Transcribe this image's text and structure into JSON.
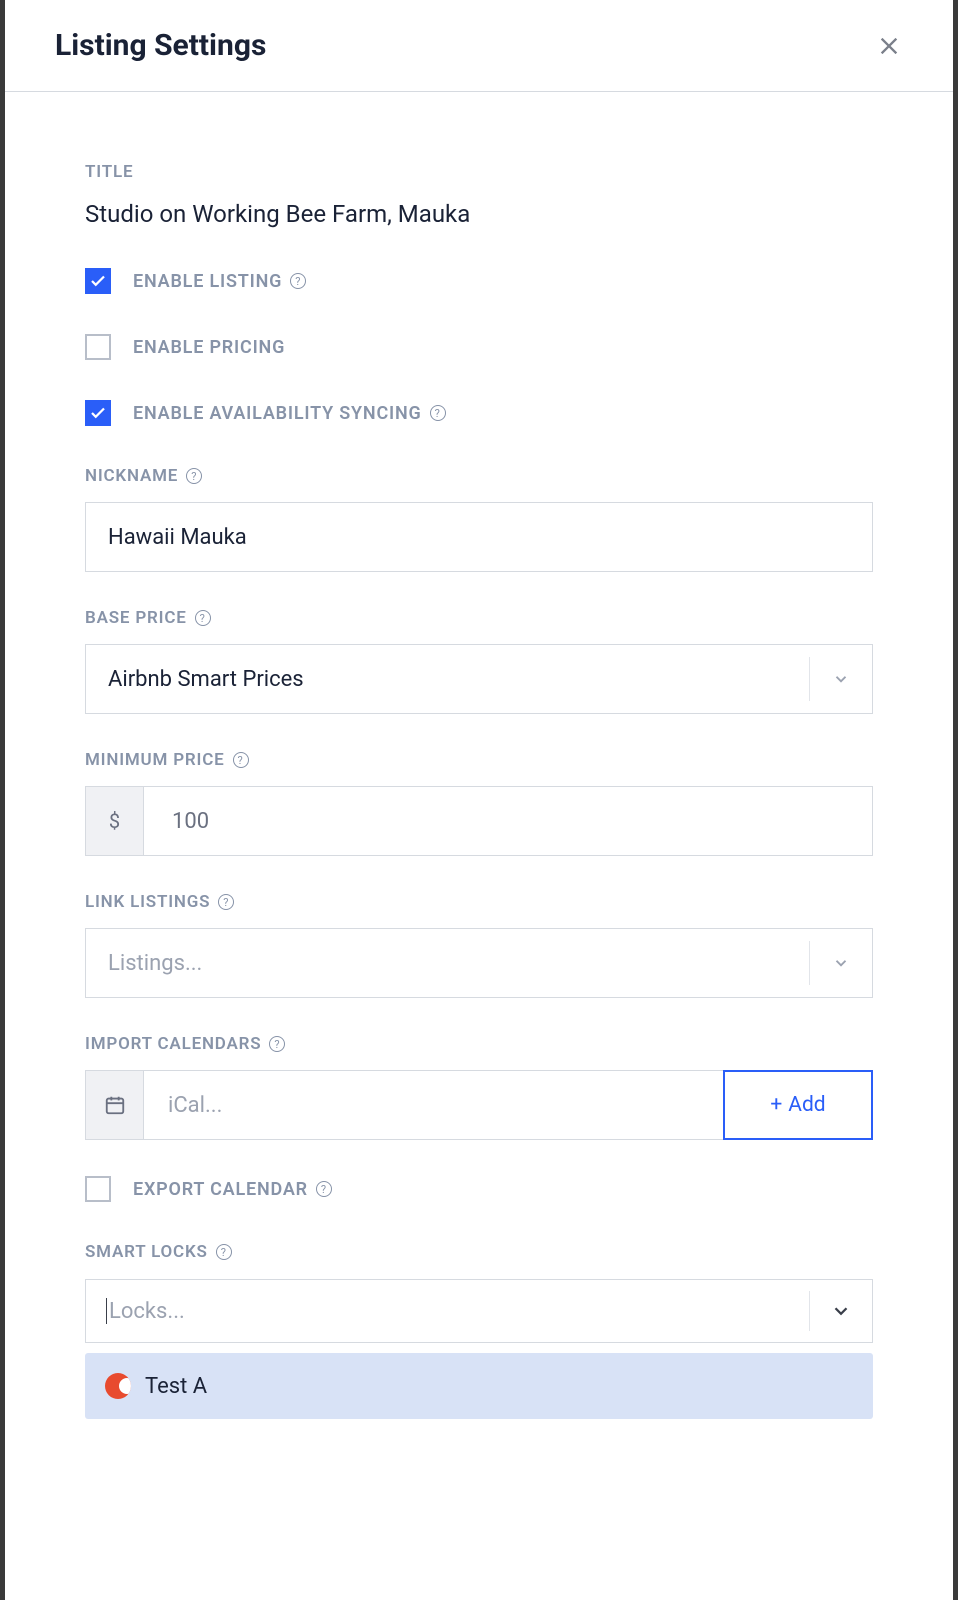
{
  "header": {
    "title": "Listing Settings"
  },
  "fields": {
    "title_label": "TITLE",
    "title_value": "Studio on Working Bee Farm, Mauka",
    "enable_listing_label": "ENABLE LISTING",
    "enable_listing_checked": true,
    "enable_pricing_label": "ENABLE PRICING",
    "enable_pricing_checked": false,
    "enable_availability_label": "ENABLE AVAILABILITY SYNCING",
    "enable_availability_checked": true,
    "nickname_label": "NICKNAME",
    "nickname_value": "Hawaii Mauka",
    "base_price_label": "BASE PRICE",
    "base_price_value": "Airbnb Smart Prices",
    "min_price_label": "MINIMUM PRICE",
    "min_price_currency": "$",
    "min_price_value": "100",
    "link_listings_label": "LINK LISTINGS",
    "link_listings_placeholder": "Listings...",
    "import_calendars_label": "IMPORT CALENDARS",
    "ical_placeholder": "iCal...",
    "add_button": "Add",
    "export_calendar_label": "EXPORT CALENDAR",
    "export_calendar_checked": false,
    "smart_locks_label": "SMART LOCKS",
    "smart_locks_placeholder": "Locks...",
    "smart_locks_options": [
      {
        "label": "Test A"
      }
    ]
  }
}
